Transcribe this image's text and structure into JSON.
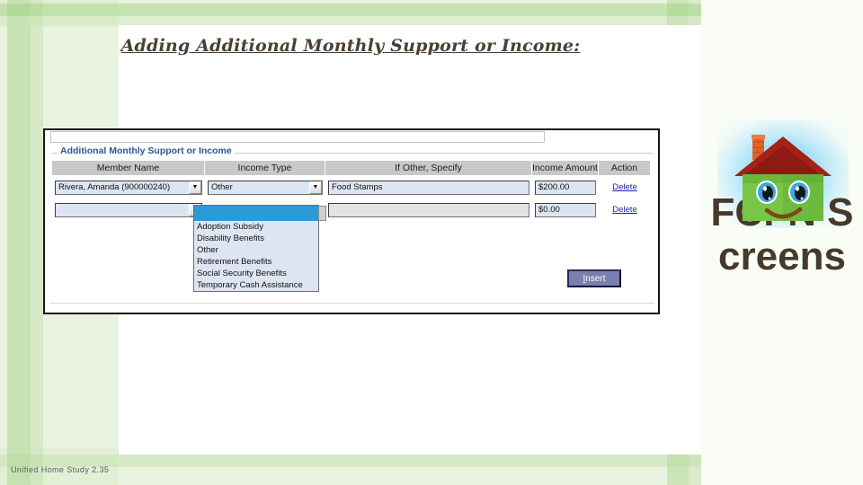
{
  "slide": {
    "title": "Adding Additional Monthly Support or Income:",
    "footer": "Unified Home Study 2.35"
  },
  "logo": {
    "icon_name": "smiling-house-logo",
    "brand_text": "FCFN Screens",
    "house_body_color": "#6cba3f",
    "roof_color": "#a81f16",
    "glow_color": "#7fd2f2",
    "text_color": "#453a2c"
  },
  "screenshot": {
    "fieldset_legend": "Additional Monthly Support or Income",
    "legend_color": "#2c5592",
    "columns": [
      "Member Name",
      "Income Type",
      "If Other, Specify",
      "Income Amount",
      "Action"
    ],
    "rows": [
      {
        "member": "Rivera, Amanda (900000240)",
        "income_type": "Other",
        "if_other": "Food Stamps",
        "amount": "$200.00",
        "action": "Delete",
        "if_other_disabled": false
      },
      {
        "member": "",
        "income_type": "",
        "if_other": "",
        "amount": "$0.00",
        "action": "Delete",
        "if_other_disabled": true
      }
    ],
    "dropdown": {
      "open": true,
      "selected": "",
      "options": [
        "",
        "Adoption Subsidy",
        "Disability Benefits",
        "Other",
        "Retirement Benefits",
        "Social Security Benefits",
        "Temporary Cash Assistance"
      ],
      "highlight_color": "#2a9bd8"
    },
    "insert_button": {
      "accel": "I",
      "rest": "nsert"
    },
    "dropdown_arrow_glyph": "☰"
  }
}
